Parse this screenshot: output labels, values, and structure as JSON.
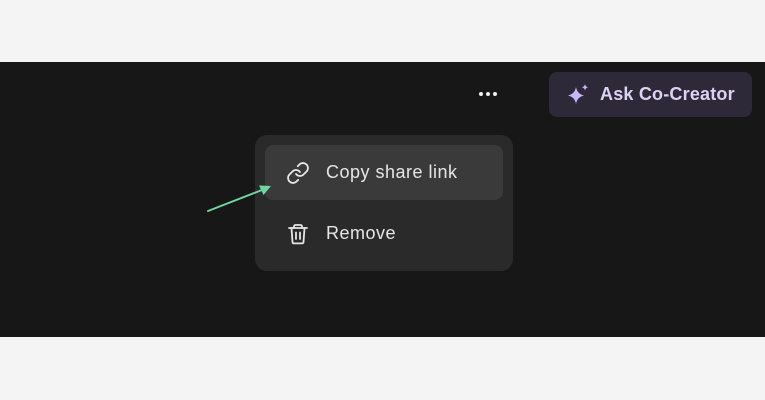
{
  "toolbar": {
    "more_icon": "more-horizontal-icon",
    "ask_button": {
      "label": "Ask Co-Creator",
      "icon": "sparkle-icon",
      "text_color": "#dcd2f4",
      "background": "#2d2938",
      "icon_color": "#c9b6f5"
    }
  },
  "menu": {
    "items": [
      {
        "label": "Copy share link",
        "icon": "link-icon",
        "highlighted": true
      },
      {
        "label": "Remove",
        "icon": "trash-icon",
        "highlighted": false
      }
    ]
  },
  "colors": {
    "page_background": "#f4f4f4",
    "panel_background": "#171717",
    "menu_background": "#2a2a2a",
    "menu_item_highlight": "#3a3a3a",
    "annotation_arrow": "#6fd4a0"
  }
}
